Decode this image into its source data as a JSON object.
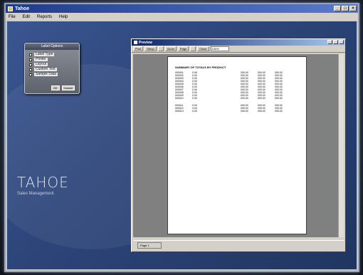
{
  "app": {
    "title": "Tahoe",
    "window_buttons": [
      "_",
      "□",
      "×"
    ]
  },
  "menu": [
    "File",
    "Edit",
    "Reports",
    "Help"
  ],
  "panel": {
    "header": "Label Options",
    "items": [
      "Label Type",
      "Printer",
      "Layout",
      "Custom Text",
      "Sample Data"
    ],
    "footer_buttons": [
      "OK",
      "Cancel"
    ]
  },
  "brand": {
    "name": "TAHOE",
    "tagline": "Sales Management"
  },
  "preview": {
    "title": "Preview",
    "window_buttons": [
      "_",
      "□",
      "×"
    ],
    "toolbar": [
      "Print",
      "Setup",
      "",
      "Zoom",
      "Page",
      "",
      "Close"
    ],
    "zoom_value": "100%",
    "report": {
      "title": "SUMMARY OF TOTALS BY PRODUCT",
      "groups": [
        [
          [
            "000001",
            "0.00",
            "",
            "000.00",
            "000.00",
            "000.00"
          ],
          [
            "000002",
            "0.00",
            "",
            "000.00",
            "000.00",
            "000.00"
          ],
          [
            "000003",
            "0.00",
            "",
            "000.00",
            "000.00",
            "000.00"
          ],
          [
            "000004",
            "0.00",
            "",
            "000.00",
            "000.00",
            "000.00"
          ],
          [
            "000005",
            "0.00",
            "",
            "000.00",
            "000.00",
            "000.00"
          ],
          [
            "000006",
            "0.00",
            "",
            "000.00",
            "000.00",
            "000.00"
          ],
          [
            "000007",
            "0.00",
            "",
            "000.00",
            "000.00",
            "000.00"
          ],
          [
            "000008",
            "0.00",
            "",
            "000.00",
            "000.00",
            "000.00"
          ],
          [
            "000009",
            "0.00",
            "",
            "000.00",
            "000.00",
            "000.00"
          ],
          [
            "000010",
            "0.00",
            "",
            "000.00",
            "000.00",
            "000.00"
          ]
        ],
        [
          [
            "000011",
            "0.00",
            "",
            "000.00",
            "000.00",
            "000.00"
          ],
          [
            "000012",
            "0.00",
            "",
            "000.00",
            "000.00",
            "000.00"
          ],
          [
            "000013",
            "0.00",
            "",
            "000.00",
            "000.00",
            "000.00"
          ]
        ]
      ]
    },
    "status": "Page 1"
  }
}
